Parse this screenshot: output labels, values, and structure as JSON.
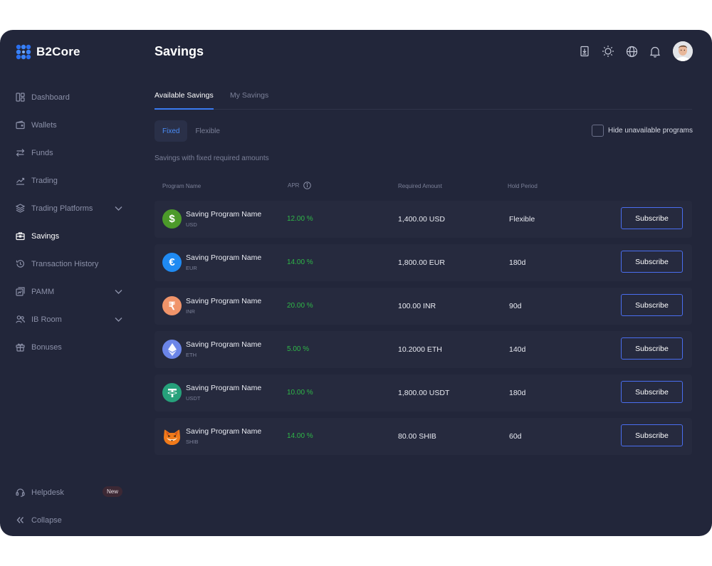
{
  "app": {
    "name": "B2Core"
  },
  "sidebar": {
    "items": [
      {
        "label": "Dashboard",
        "icon": "dashboard-icon",
        "active": false
      },
      {
        "label": "Wallets",
        "icon": "wallet-icon",
        "active": false
      },
      {
        "label": "Funds",
        "icon": "transfer-icon",
        "active": false
      },
      {
        "label": "Trading",
        "icon": "chart-line-icon",
        "active": false
      },
      {
        "label": "Trading Platforms",
        "icon": "layers-icon",
        "active": false,
        "expandable": true
      },
      {
        "label": "Savings",
        "icon": "savings-icon",
        "active": true
      },
      {
        "label": "Transaction History",
        "icon": "history-icon",
        "active": false
      },
      {
        "label": "PAMM",
        "icon": "pamm-icon",
        "active": false,
        "expandable": true
      },
      {
        "label": "IB Room",
        "icon": "users-icon",
        "active": false,
        "expandable": true
      },
      {
        "label": "Bonuses",
        "icon": "gift-icon",
        "active": false
      }
    ],
    "helpdesk": {
      "label": "Helpdesk",
      "badge": "New"
    },
    "collapse": {
      "label": "Collapse"
    }
  },
  "header": {
    "title": "Savings",
    "icons": [
      "download-icon",
      "sun-icon",
      "globe-icon",
      "bell-icon"
    ]
  },
  "tabs": [
    {
      "label": "Available Savings",
      "active": true
    },
    {
      "label": "My Savings",
      "active": false
    }
  ],
  "subtabs": [
    {
      "label": "Fixed",
      "active": true
    },
    {
      "label": "Flexible",
      "active": false
    }
  ],
  "hide_unavailable": {
    "label": "Hide unavailable programs",
    "checked": false
  },
  "description": "Savings with fixed required amounts",
  "table": {
    "columns": {
      "program_name": "Program Name",
      "apr": "APR",
      "required_amount": "Required Amount",
      "hold_period": "Hold Period"
    },
    "rows": [
      {
        "name": "Saving Program Name",
        "currency": "USD",
        "apr": "12.00 %",
        "amount": "1,400.00 USD",
        "hold": "Flexible",
        "action": "Subscribe",
        "coin_icon": "usd-coin-icon",
        "coin_color": "#4c9a2a"
      },
      {
        "name": "Saving Program Name",
        "currency": "EUR",
        "apr": "14.00 %",
        "amount": "1,800.00 EUR",
        "hold": "180d",
        "action": "Subscribe",
        "coin_icon": "eur-coin-icon",
        "coin_color": "#1f8af2"
      },
      {
        "name": "Saving Program Name",
        "currency": "INR",
        "apr": "20.00 %",
        "amount": "100.00 INR",
        "hold": "90d",
        "action": "Subscribe",
        "coin_icon": "inr-coin-icon",
        "coin_color": "#f0946a"
      },
      {
        "name": "Saving Program Name",
        "currency": "ETH",
        "apr": "5.00 %",
        "amount": "10.2000 ETH",
        "hold": "140d",
        "action": "Subscribe",
        "coin_icon": "eth-coin-icon",
        "coin_color": "#6b85e8"
      },
      {
        "name": "Saving Program Name",
        "currency": "USDT",
        "apr": "10.00 %",
        "amount": "1,800.00 USDT",
        "hold": "180d",
        "action": "Subscribe",
        "coin_icon": "usdt-coin-icon",
        "coin_color": "#26a17b"
      },
      {
        "name": "Saving Program Name",
        "currency": "SHIB",
        "apr": "14.00 %",
        "amount": "80.00 SHIB",
        "hold": "60d",
        "action": "Subscribe",
        "coin_icon": "shib-coin-icon",
        "coin_color": "#f07a1a"
      }
    ]
  },
  "colors": {
    "accent": "#3a7af0",
    "positive": "#2fb848",
    "background": "#22263a"
  }
}
